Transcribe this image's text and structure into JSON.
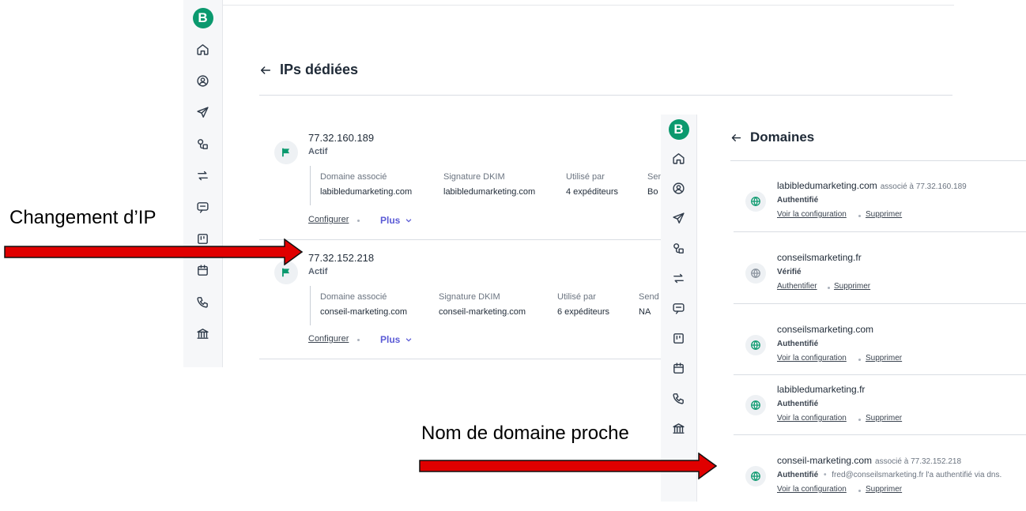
{
  "sidebar_icons": [
    "logo-icon",
    "home-icon",
    "contacts-icon",
    "send-icon",
    "automation-icon",
    "transactional-icon",
    "conversations-icon",
    "deals-icon",
    "meetings-icon",
    "phone-icon",
    "bank-icon"
  ],
  "ip_page": {
    "title": "IPs dédiées",
    "ips": [
      {
        "address": "77.32.160.189",
        "status": "Actif",
        "headers": [
          "Domaine associé",
          "Signature DKIM",
          "Utilisé par",
          "Sen"
        ],
        "values": [
          "labibledumarketing.com",
          "labibledumarketing.com",
          "4 expéditeurs",
          "Bo"
        ],
        "configure": "Configurer",
        "more": "Plus"
      },
      {
        "address": "77.32.152.218",
        "status": "Actif",
        "headers": [
          "Domaine associé",
          "Signature DKIM",
          "Utilisé par",
          "Send"
        ],
        "values": [
          "conseil-marketing.com",
          "conseil-marketing.com",
          "6 expéditeurs",
          "NA"
        ],
        "configure": "Configurer",
        "more": "Plus"
      }
    ]
  },
  "domain_page": {
    "title": "Domaines",
    "domains": [
      {
        "name": "labibledumarketing.com",
        "assoc": "associé à 77.32.160.189",
        "status": "Authentifié",
        "note": "",
        "action": "Voir la configuration",
        "delete": "Supprimer",
        "verified_only": false
      },
      {
        "name": "conseilsmarketing.fr",
        "assoc": "",
        "status": "Vérifié",
        "note": "",
        "action": "Authentifier",
        "delete": "Supprimer",
        "verified_only": true
      },
      {
        "name": "conseilsmarketing.com",
        "assoc": "",
        "status": "Authentifié",
        "note": "",
        "action": "Voir la configuration",
        "delete": "Supprimer",
        "verified_only": false
      },
      {
        "name": "labibledumarketing.fr",
        "assoc": "",
        "status": "Authentifié",
        "note": "",
        "action": "Voir la configuration",
        "delete": "Supprimer",
        "verified_only": false
      },
      {
        "name": "conseil-marketing.com",
        "assoc": "associé à 77.32.152.218",
        "status": "Authentifié",
        "note": "fred@conseilsmarketing.fr l'a authentifié via dns.",
        "action": "Voir la configuration",
        "delete": "Supprimer",
        "verified_only": false
      }
    ]
  },
  "annotations": {
    "ip_change": "Changement d’IP",
    "near_domain": "Nom de domaine proche"
  },
  "colors": {
    "brand": "#0b996e",
    "arrow": "#e00000",
    "link_accent": "#5b5bd6"
  }
}
